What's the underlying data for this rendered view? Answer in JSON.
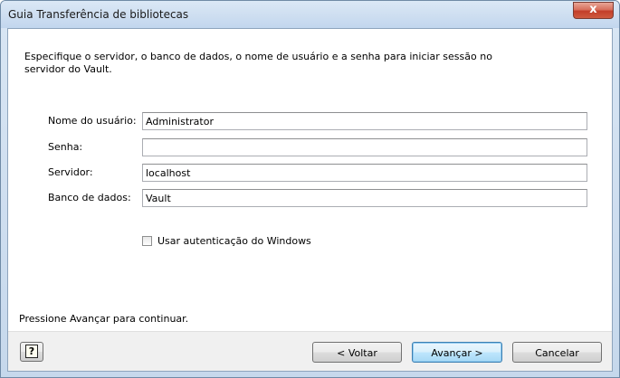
{
  "window": {
    "title": "Guia Transferência de bibliotecas",
    "close_label": "x"
  },
  "intro_text": "Especifique o servidor, o banco de dados, o nome de usuário e a senha para iniciar sessão no servidor do Vault.",
  "fields": {
    "username": {
      "label": "Nome do usuário:",
      "value": "Administrator"
    },
    "password": {
      "label": "Senha:",
      "value": ""
    },
    "server": {
      "label": "Servidor:",
      "value": "localhost"
    },
    "database": {
      "label": "Banco de dados:",
      "value": "Vault"
    }
  },
  "windows_auth": {
    "label": "Usar autenticação do Windows",
    "checked": false
  },
  "hint": "Pressione Avançar para continuar.",
  "buttons": {
    "help_glyph": "?",
    "back": "< Voltar",
    "next": "Avançar >",
    "cancel": "Cancelar"
  },
  "icons": [
    "close-icon",
    "help-icon"
  ]
}
